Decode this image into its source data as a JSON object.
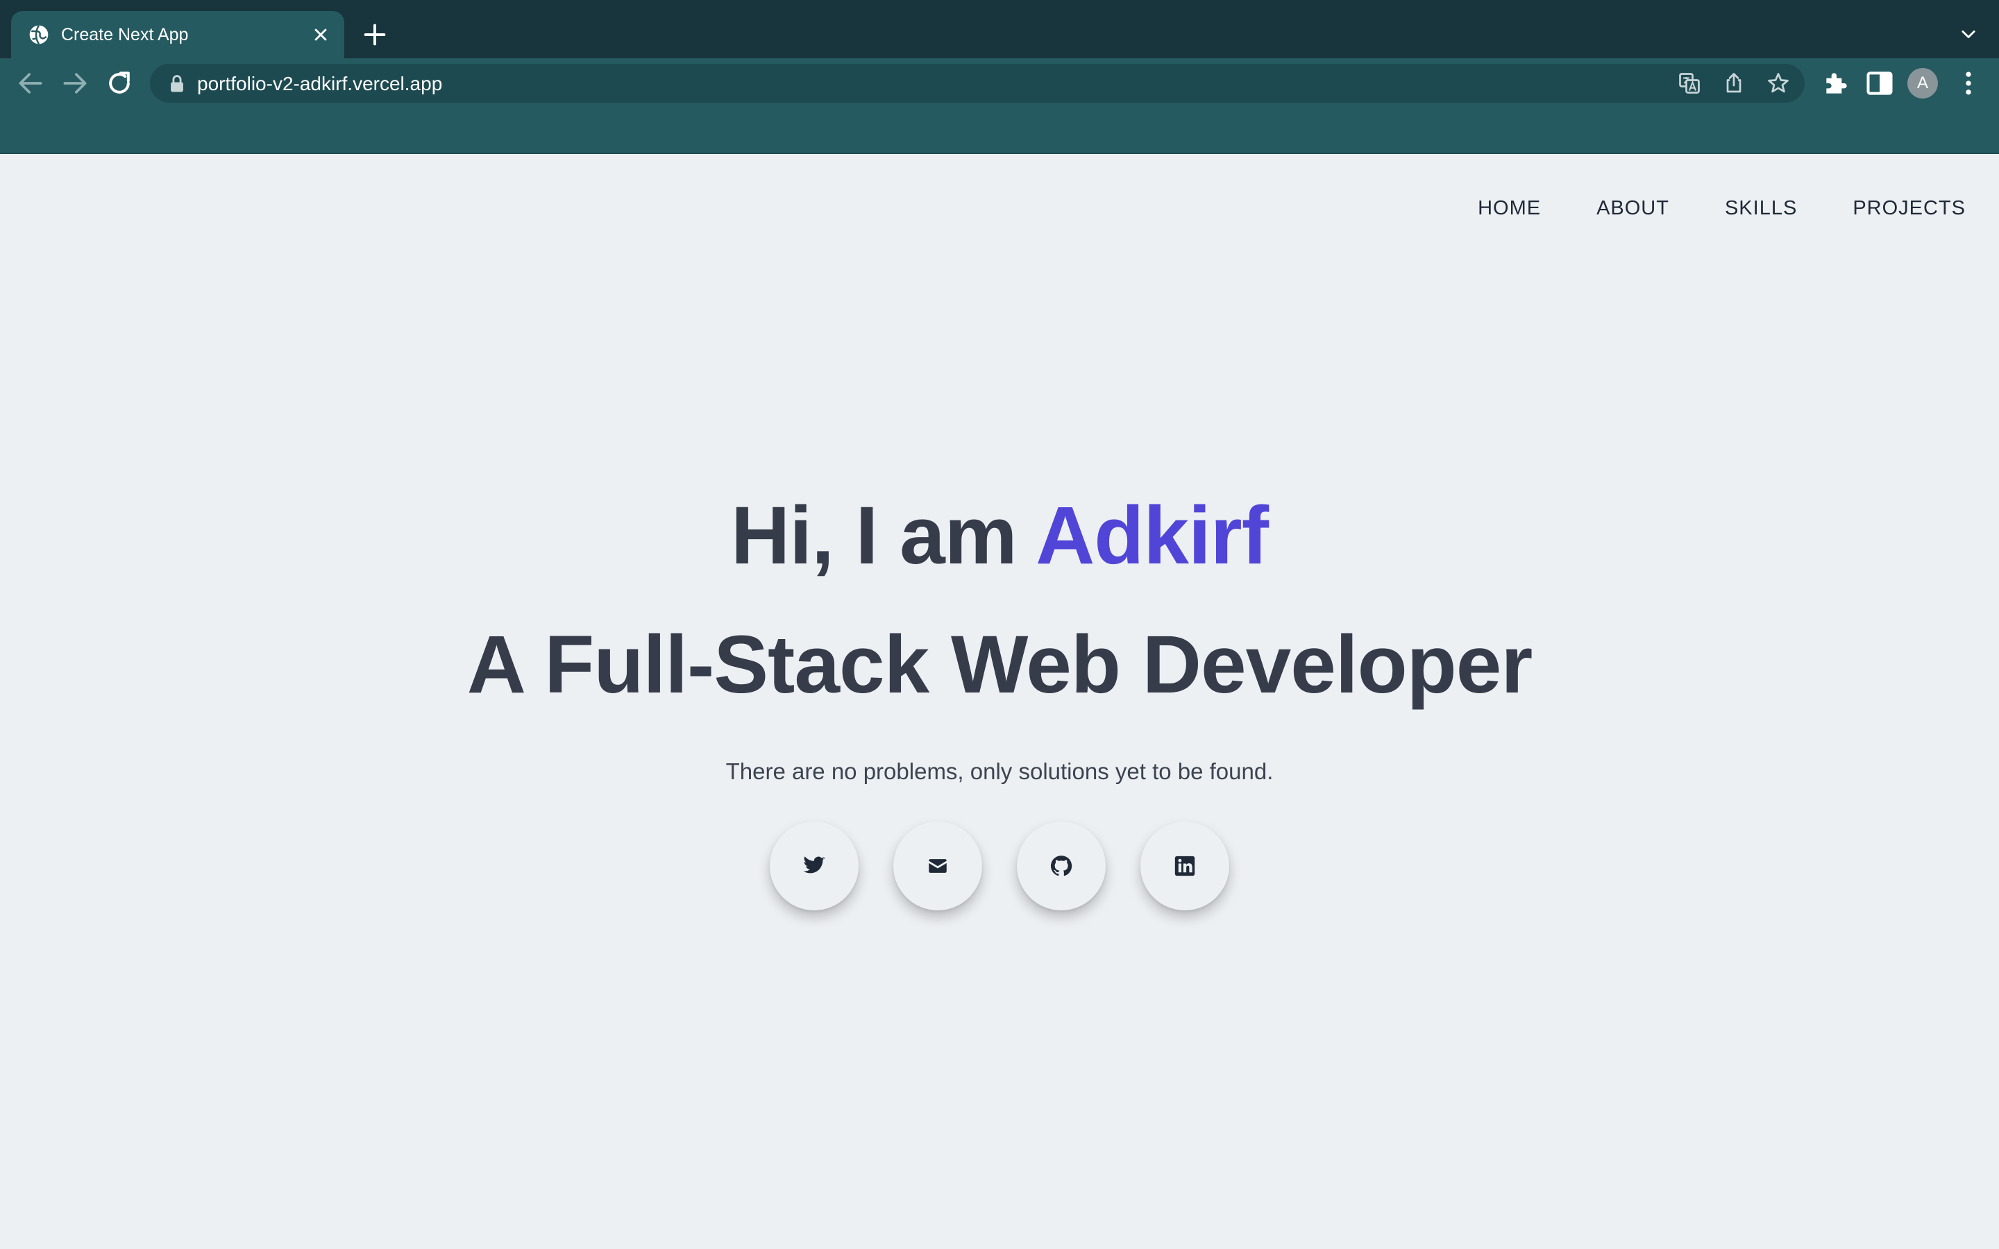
{
  "browser": {
    "tab_title": "Create Next App",
    "url": "portfolio-v2-adkirf.vercel.app",
    "profile_initial": "A"
  },
  "nav": {
    "items": [
      "HOME",
      "ABOUT",
      "SKILLS",
      "PROJECTS"
    ]
  },
  "hero": {
    "greeting": "Hi, I am ",
    "name": "Adkirf",
    "role": "A Full-Stack Web Developer",
    "tagline": "There are no problems, only solutions yet to be found."
  },
  "socials": {
    "icons": [
      "twitter-icon",
      "mail-icon",
      "github-icon",
      "linkedin-icon"
    ]
  },
  "colors": {
    "accent": "#5145d8",
    "heading": "#373c4b",
    "page_background": "#edf0f3",
    "browser_frame": "#255a60"
  }
}
